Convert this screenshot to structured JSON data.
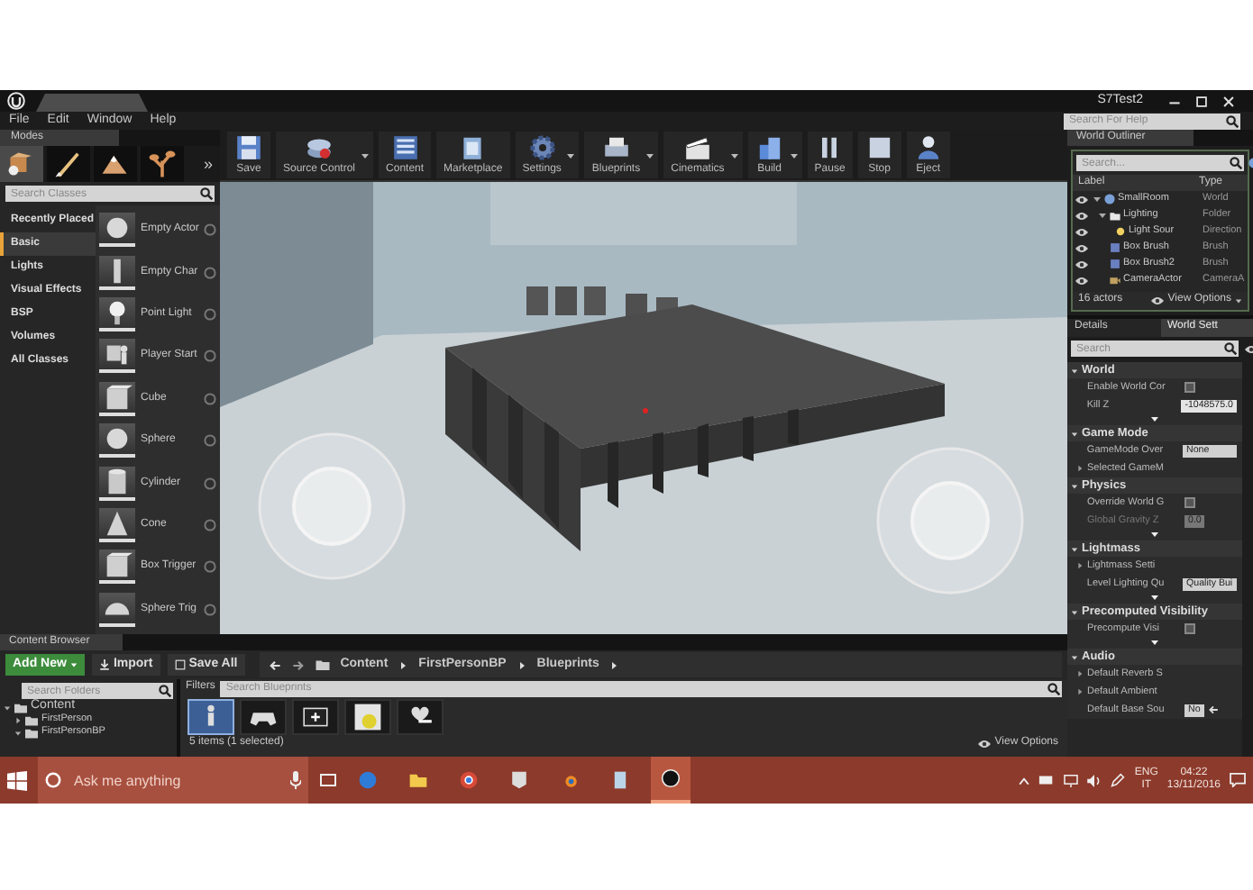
{
  "title_bar": {
    "project": "S7Test2"
  },
  "menu": [
    "File",
    "Edit",
    "Window",
    "Help"
  ],
  "help_search": {
    "placeholder": "Search For Help"
  },
  "modes": {
    "tab": "Modes",
    "more": "»",
    "tools": [
      {
        "kind": "place",
        "selected": true
      },
      {
        "kind": "paint",
        "selected": false
      },
      {
        "kind": "landscape",
        "selected": false
      },
      {
        "kind": "foliage",
        "selected": false
      }
    ],
    "search": {
      "placeholder": "Search Classes"
    },
    "categories": [
      {
        "label": "Recently Placed",
        "selected": false
      },
      {
        "label": "Basic",
        "selected": true
      },
      {
        "label": "Lights",
        "selected": false
      },
      {
        "label": "Visual Effects",
        "selected": false
      },
      {
        "label": "BSP",
        "selected": false
      },
      {
        "label": "Volumes",
        "selected": false
      },
      {
        "label": "All Classes",
        "selected": false
      }
    ],
    "classes": [
      {
        "label": "Empty Actor",
        "kind": "ball"
      },
      {
        "label": "Empty Char",
        "kind": "pillar"
      },
      {
        "label": "Point Light",
        "kind": "bulb"
      },
      {
        "label": "Player Start",
        "kind": "flag"
      },
      {
        "label": "Cube",
        "kind": "cube"
      },
      {
        "label": "Sphere",
        "kind": "ball"
      },
      {
        "label": "Cylinder",
        "kind": "cylinder"
      },
      {
        "label": "Cone",
        "kind": "cone"
      },
      {
        "label": "Box Trigger",
        "kind": "cube"
      },
      {
        "label": "Sphere Trig",
        "kind": "dome"
      }
    ]
  },
  "toolbar": [
    {
      "label": "Save",
      "kind": "save",
      "dropdown": false
    },
    {
      "label": "Source Control",
      "kind": "source",
      "dropdown": true
    },
    {
      "label": "Content",
      "kind": "content",
      "dropdown": false
    },
    {
      "label": "Marketplace",
      "kind": "market",
      "dropdown": false
    },
    {
      "label": "Settings",
      "kind": "settings",
      "dropdown": true
    },
    {
      "label": "Blueprints",
      "kind": "blueprints",
      "dropdown": true
    },
    {
      "label": "Cinematics",
      "kind": "cinematics",
      "dropdown": true
    },
    {
      "label": "Build",
      "kind": "build",
      "dropdown": true
    },
    {
      "label": "Pause",
      "kind": "pause",
      "dropdown": false
    },
    {
      "label": "Stop",
      "kind": "stop",
      "dropdown": false
    },
    {
      "label": "Eject",
      "kind": "eject",
      "dropdown": false
    }
  ],
  "outliner": {
    "tab": "World Outliner",
    "search": {
      "placeholder": "Search..."
    },
    "columns": [
      "Label",
      "Type"
    ],
    "rows": [
      {
        "label": "SmallRoom",
        "type": "World",
        "kind": "world",
        "expanded": true,
        "children": [
          {
            "label": "Lighting",
            "type": "Folder",
            "kind": "folder",
            "expanded": true,
            "children": [
              {
                "label": "Light Sour",
                "type": "Direction",
                "kind": "light"
              }
            ]
          },
          {
            "label": "Box Brush",
            "type": "Brush",
            "kind": "brush"
          },
          {
            "label": "Box Brush2",
            "type": "Brush",
            "kind": "brush"
          },
          {
            "label": "CameraActor",
            "type": "CameraA",
            "kind": "camera"
          }
        ]
      }
    ],
    "count": "16 actors",
    "view_options": "View Options"
  },
  "details": {
    "tabs": [
      {
        "label": "Details",
        "selected": false
      },
      {
        "label": "World Sett",
        "selected": true
      }
    ],
    "search": {
      "placeholder": "Search"
    },
    "sections": [
      {
        "title": "World",
        "advanced": true,
        "rows": [
          {
            "kind": "checkbox",
            "label": "Enable World Cor",
            "checked": false
          },
          {
            "kind": "number",
            "label": "Kill Z",
            "value": "-1048575.0",
            "disabled": false
          }
        ]
      },
      {
        "title": "Game Mode",
        "advanced": false,
        "rows": [
          {
            "kind": "dropdown",
            "label": "GameMode Over",
            "value": "None"
          },
          {
            "kind": "group",
            "label": "Selected GameM"
          }
        ]
      },
      {
        "title": "Physics",
        "advanced": true,
        "rows": [
          {
            "kind": "checkbox",
            "label": "Override World G",
            "checked": false
          },
          {
            "kind": "number",
            "label": "Global Gravity Z",
            "value": "0.0",
            "disabled": true
          }
        ]
      },
      {
        "title": "Lightmass",
        "advanced": true,
        "rows": [
          {
            "kind": "group",
            "label": "Lightmass Setti"
          },
          {
            "kind": "dropdown",
            "label": "Level Lighting Qu",
            "value": "Quality Bui"
          }
        ]
      },
      {
        "title": "Precomputed Visibility",
        "advanced": true,
        "rows": [
          {
            "kind": "checkbox",
            "label": "Precompute Visi",
            "checked": false
          }
        ]
      },
      {
        "title": "Audio",
        "advanced": false,
        "rows": [
          {
            "kind": "group",
            "label": "Default Reverb S"
          },
          {
            "kind": "group",
            "label": "Default Ambient"
          },
          {
            "kind": "asset",
            "label": "Default Base Sou",
            "value": "No"
          }
        ]
      }
    ]
  },
  "content_browser": {
    "tab": "Content Browser",
    "add_new": "Add New",
    "import": "Import",
    "save_all": "Save All",
    "path": [
      "Content",
      "FirstPersonBP",
      "Blueprints"
    ],
    "folder_search": {
      "placeholder": "Search Folders"
    },
    "folders": [
      {
        "label": "Content",
        "expanded": true,
        "children": [
          {
            "label": "FirstPerson",
            "expanded": false
          },
          {
            "label": "FirstPersonBP",
            "expanded": true
          }
        ]
      }
    ],
    "filters": "Filters",
    "asset_search": {
      "placeholder": "Search Blueprints"
    },
    "assets": [
      {
        "kind": "character",
        "selected": true
      },
      {
        "kind": "gamepad",
        "selected": false
      },
      {
        "kind": "hud",
        "selected": false
      },
      {
        "kind": "projectile",
        "selected": false
      },
      {
        "kind": "widget",
        "selected": false
      }
    ],
    "status": "5 items (1 selected)",
    "view_options": "View Options"
  },
  "taskbar": {
    "search": {
      "placeholder": "Ask me anything"
    },
    "apps": [
      {
        "kind": "edge",
        "active": false
      },
      {
        "kind": "folder",
        "active": false
      },
      {
        "kind": "chrome",
        "active": false
      },
      {
        "kind": "epic",
        "active": false
      },
      {
        "kind": "blender",
        "active": false
      },
      {
        "kind": "notepad",
        "active": false
      },
      {
        "kind": "unreal",
        "active": true
      }
    ],
    "language": "ENG",
    "layout": "IT",
    "time": "04:22",
    "date": "13/11/2016"
  }
}
